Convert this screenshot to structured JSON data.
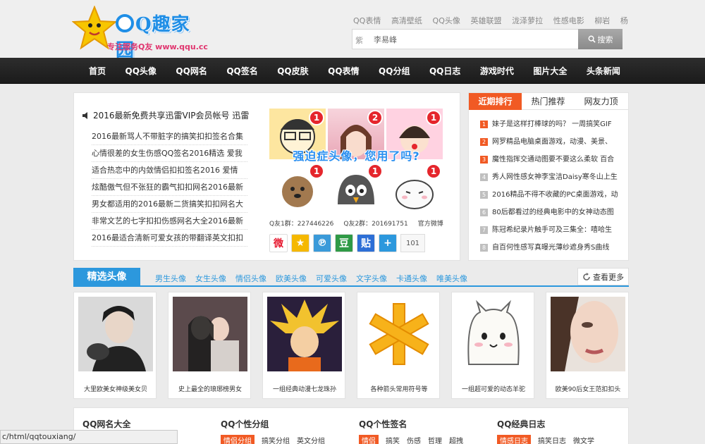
{
  "header": {
    "logo_text": "Q趣家园",
    "logo_slogan": "专注服务Q友 www.qqu.cc",
    "toplinks": [
      "QQ表情",
      "高清壁纸",
      "QQ头像",
      "英雄联盟",
      "泷泽萝拉",
      "性感电影",
      "柳岩",
      "杨"
    ],
    "search": {
      "prefix": "紫",
      "value": "李易峰",
      "button": "搜索"
    }
  },
  "nav": [
    "首页",
    "QQ头像",
    "QQ网名",
    "QQ签名",
    "QQ皮肤",
    "QQ表情",
    "QQ分组",
    "QQ日志",
    "游戏时代",
    "图片大全",
    "头条新闻"
  ],
  "news": {
    "headline": "2016最新免费共享迅雷VIP会员帐号 迅雷",
    "items": [
      "2016最新骂人不带脏字的搞笑扣扣签名合集",
      "心情很差的女生伤感QQ签名2016精选 爱我",
      "适合热恋中的内敛情侣扣扣签名2016 爱情",
      "炫酷傲气但不张狂的霸气扣扣网名2016最新",
      "男女都适用的2016最新二货搞笑扣扣网名大",
      "非常文艺的七字扣扣伤感网名大全2016最新",
      "2016最适合清新可爱女孩的带翻译英文扣扣"
    ],
    "avatar_badges": [
      "1",
      "2",
      "1",
      "1",
      "1",
      "1"
    ],
    "banner": "强迫症头像，您用了吗?",
    "qq_groups": [
      "Q友1群：227446226",
      "Q友2群：201691751",
      "官方微博"
    ],
    "share_icons": [
      "weibo-icon",
      "qzone-icon",
      "tencent-weibo-icon",
      "douban-icon",
      "tieba-icon",
      "more-share-icon"
    ],
    "share_labels": [
      "微",
      "★",
      "℗",
      "豆",
      "贴",
      "+"
    ],
    "share_count": "101"
  },
  "rank": {
    "tabs": [
      "近期排行",
      "热门推荐",
      "网友力顶"
    ],
    "items": [
      {
        "n": "1",
        "text": "妹子是这样打棒球的吗？ 一周搞笑GIF"
      },
      {
        "n": "2",
        "text": "网罗精品电脑桌面游戏，动漫、美景、"
      },
      {
        "n": "3",
        "text": "魔性指挥交通动图要不要这么柔软 百合"
      },
      {
        "n": "4",
        "text": "秀人网性感女神李宝洁Daisy寒冬山上生"
      },
      {
        "n": "5",
        "text": "2016精品不得不收藏的PC桌面游戏，动"
      },
      {
        "n": "6",
        "text": "80后都看过的经典电影中的女神动态图"
      },
      {
        "n": "7",
        "text": "陈冠希纪录片触手可及三集全：嘻哈生"
      },
      {
        "n": "8",
        "text": "自百何性感写真曝光薄纱遮身秀S曲线"
      }
    ]
  },
  "featured": {
    "title": "精选头像",
    "tabs": [
      "男生头像",
      "女生头像",
      "情侣头像",
      "欧美头像",
      "可爱头像",
      "文字头像",
      "卡通头像",
      "唯美头像"
    ],
    "more": "查看更多",
    "cards": [
      "大里欧美女神级美女贝",
      "史上最全的琅琊榜男女",
      "一组经典动漫七龙珠孙",
      "各种箭头常用符号等",
      "一组超可爱的动态羊驼",
      "欧美90后女王范扣扣头"
    ]
  },
  "bottom": {
    "columns": [
      {
        "title": "QQ网名大全",
        "subs": []
      },
      {
        "title": "QQ个性分组",
        "subs": [
          "情侣分组",
          "搞笑分组",
          "英文分组"
        ]
      },
      {
        "title": "QQ个性签名",
        "subs": [
          "情侣",
          "搞笑",
          "伤感",
          "哲理",
          "超拽"
        ]
      },
      {
        "title": "QQ经典日志",
        "subs": [
          "情感日志",
          "搞笑日志",
          "微文学"
        ]
      }
    ]
  },
  "statusbar": "c/html/qqtouxiang/",
  "colors": {
    "accent_blue": "#2c98dd",
    "accent_orange": "#f15a24",
    "nav_bg": "#222222"
  }
}
